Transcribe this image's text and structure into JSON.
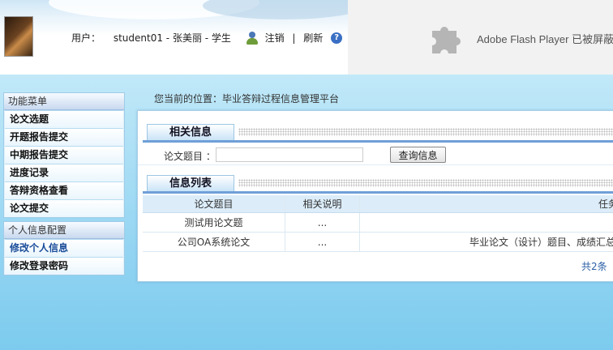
{
  "header": {
    "user_label": "用户：",
    "user_value": "student01 - 张美丽 - 学生",
    "logout": "注销",
    "separator": "|",
    "refresh": "刷新",
    "help": "?"
  },
  "flash": {
    "message": "Adobe Flash Player 已被屏蔽"
  },
  "sidebar": {
    "group1": {
      "title": "功能菜单",
      "items": [
        {
          "label": "论文选题"
        },
        {
          "label": "开题报告提交"
        },
        {
          "label": "中期报告提交"
        },
        {
          "label": "进度记录"
        },
        {
          "label": "答辩资格查看"
        },
        {
          "label": "论文提交"
        }
      ]
    },
    "group2": {
      "title": "个人信息配置",
      "items": [
        {
          "label": "修改个人信息",
          "active": true
        },
        {
          "label": "修改登录密码"
        }
      ]
    }
  },
  "breadcrumb": "您当前的位置：毕业答辩过程信息管理平台",
  "search_section": {
    "title": "相关信息",
    "field_label": "论文题目 ：",
    "field_value": "",
    "button": "查询信息"
  },
  "list_section": {
    "title": "信息列表",
    "columns": [
      "论文题目",
      "相关说明",
      "任务书"
    ],
    "rows": [
      [
        "测试用论文题",
        "...",
        ""
      ],
      [
        "公司OA系统论文",
        "...",
        "毕业论文（设计）题目、成绩汇总"
      ]
    ],
    "pager": "共2条"
  },
  "colors": {
    "accent": "#6f9fd8",
    "link": "#2a5fa5",
    "active_menu": "#1b4d9a"
  }
}
